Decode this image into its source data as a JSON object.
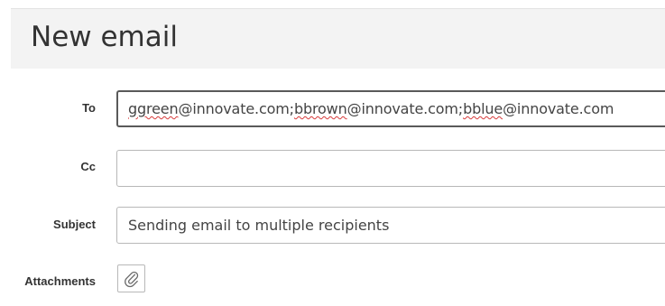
{
  "header": {
    "title": "New email"
  },
  "form": {
    "to": {
      "label": "To",
      "recipients": [
        {
          "segments": [
            {
              "text": "ggreen",
              "misspelled": true
            },
            {
              "text": "@innovate.com;",
              "misspelled": false
            }
          ]
        },
        {
          "segments": [
            {
              "text": "bbrown",
              "misspelled": true
            },
            {
              "text": "@innovate.com;",
              "misspelled": false
            }
          ]
        },
        {
          "segments": [
            {
              "text": "bblue",
              "misspelled": true
            },
            {
              "text": "@innovate.com",
              "misspelled": false
            }
          ]
        }
      ]
    },
    "cc": {
      "label": "Cc",
      "value": ""
    },
    "subject": {
      "label": "Subject",
      "value": "Sending email to multiple recipients"
    },
    "attachments": {
      "label": "Attachments",
      "icon": "paperclip-icon"
    }
  },
  "colors": {
    "header_background": "#f3f3f3",
    "input_border": "#b8b8b8",
    "focused_border": "#5a5a5a",
    "spellcheck_underline": "#d83b3b"
  }
}
